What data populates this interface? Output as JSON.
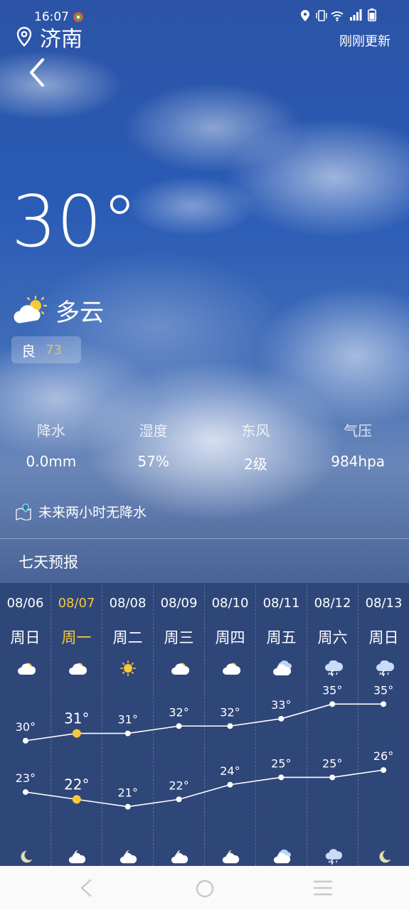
{
  "status": {
    "time": "16:07",
    "icons": [
      "location-icon",
      "vibrate-icon",
      "wifi-icon",
      "signal-icon",
      "battery-icon"
    ]
  },
  "header": {
    "city": "济南",
    "updated": "刚刚更新"
  },
  "current": {
    "temperature": "30°",
    "condition": "多云",
    "aqi_label": "良",
    "aqi_value": "73"
  },
  "stats": [
    {
      "label": "降水",
      "value": "0.0mm"
    },
    {
      "label": "湿度",
      "value": "57%"
    },
    {
      "label": "东风",
      "value": "2级"
    },
    {
      "label": "气压",
      "value": "984hpa"
    }
  ],
  "rain_note": "未来两小时无降水",
  "forecast_title": "七天预报",
  "days": [
    {
      "date": "08/06",
      "week": "周日",
      "icon": "partly-cloudy-icon",
      "night_icon": "moon-icon",
      "high": 30,
      "low": 23,
      "high_label": "30°",
      "low_label": "23°"
    },
    {
      "date": "08/07",
      "week": "周一",
      "icon": "partly-cloudy-icon",
      "night_icon": "cloudy-moon-icon",
      "high": 31,
      "low": 22,
      "high_label": "31°",
      "low_label": "22°"
    },
    {
      "date": "08/08",
      "week": "周二",
      "icon": "sun-icon",
      "night_icon": "cloudy-moon-icon",
      "high": 31,
      "low": 21,
      "high_label": "31°",
      "low_label": "21°"
    },
    {
      "date": "08/09",
      "week": "周三",
      "icon": "partly-cloudy-icon",
      "night_icon": "cloudy-moon-icon",
      "high": 32,
      "low": 22,
      "high_label": "32°",
      "low_label": "22°"
    },
    {
      "date": "08/10",
      "week": "周四",
      "icon": "partly-cloudy-icon",
      "night_icon": "cloudy-moon-icon",
      "high": 32,
      "low": 24,
      "high_label": "32°",
      "low_label": "24°"
    },
    {
      "date": "08/11",
      "week": "周五",
      "icon": "cloudy-icon",
      "night_icon": "cloudy-icon",
      "high": 33,
      "low": 25,
      "high_label": "33°",
      "low_label": "25°"
    },
    {
      "date": "08/12",
      "week": "周六",
      "icon": "thunderstorm-icon",
      "night_icon": "thunderstorm-icon",
      "high": 35,
      "low": 25,
      "high_label": "35°",
      "low_label": "25°"
    },
    {
      "date": "08/13",
      "week": "周日",
      "icon": "thunderstorm-icon",
      "night_icon": "moon-icon",
      "high": 35,
      "low": 26,
      "high_label": "35°",
      "low_label": "26°"
    }
  ],
  "today_index": 1,
  "colors": {
    "today": "#f5c93a",
    "aqi_good": "#d9c65a",
    "panel": "#2f4679"
  },
  "chart_data": {
    "type": "line",
    "categories": [
      "08/06",
      "08/07",
      "08/08",
      "08/09",
      "08/10",
      "08/11",
      "08/12",
      "08/13"
    ],
    "series": [
      {
        "values": [
          30,
          31,
          31,
          32,
          32,
          33,
          35,
          35
        ]
      },
      {
        "values": [
          23,
          22,
          21,
          22,
          24,
          25,
          25,
          26
        ]
      }
    ]
  },
  "navbar": {
    "buttons": [
      "back-nav-icon",
      "home-nav-icon",
      "menu-nav-icon"
    ]
  }
}
